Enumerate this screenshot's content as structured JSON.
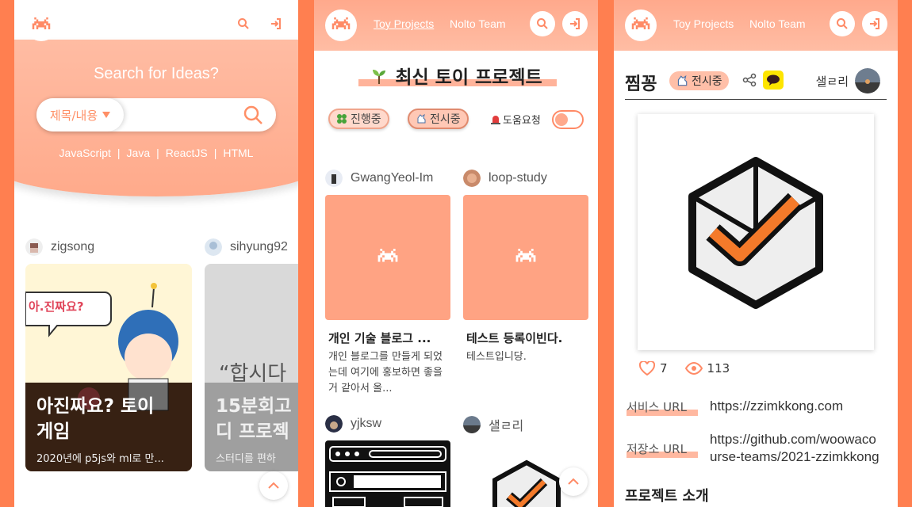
{
  "nav": {
    "toy_projects": "Toy Projects",
    "team": "Nolto Team"
  },
  "home": {
    "hero_title": "Search for Ideas?",
    "search_select": "제목/내용",
    "tags": [
      "JavaScript",
      "Java",
      "ReactJS",
      "HTML"
    ],
    "cards": [
      {
        "user": "zigsong",
        "title_line1": "아진짜요? 토이",
        "title_line2": "게임",
        "desc": "2020년에 p5js와 ml로 만..."
      },
      {
        "user": "sihyung92",
        "title_line1": "15분회고",
        "title_line2": "디 프로젝",
        "desc": "스터디를 편하",
        "quote": "“합시다"
      }
    ],
    "speech_bubble": "아.진짜요?"
  },
  "list": {
    "title": "최신 토이 프로젝트",
    "filters": {
      "in_progress": "진행중",
      "showing": "전시중",
      "help": "도움요청"
    },
    "projects": [
      {
        "user": "GwangYeol-Im",
        "title": "개인 기술 블로그 ...",
        "desc": "개인 블로그를 만들게 되었는데 여기에 홍보하면 좋을 거 같아서 올..."
      },
      {
        "user": "loop-study",
        "title": "테스트 등록이빈다.",
        "desc": "테스트입니당."
      },
      {
        "user": "yjksw"
      },
      {
        "user": "샐ㄹ리"
      }
    ]
  },
  "detail": {
    "title": "찜꽁",
    "badge": "전시중",
    "author": "샐ㄹ리",
    "likes": "7",
    "views": "113",
    "service_label": "서비스 URL",
    "service_url": "https://zzimkkong.com",
    "repo_label": "저장소 URL",
    "repo_url_line1": "https://github.com/woowaco",
    "repo_url_line2": "urse-teams/2021-zzimkkong",
    "intro_title": "프로젝트 소개"
  },
  "colors": {
    "primary": "#ff7f50",
    "header": "#ffa98c",
    "accent": "#ff8a66"
  }
}
